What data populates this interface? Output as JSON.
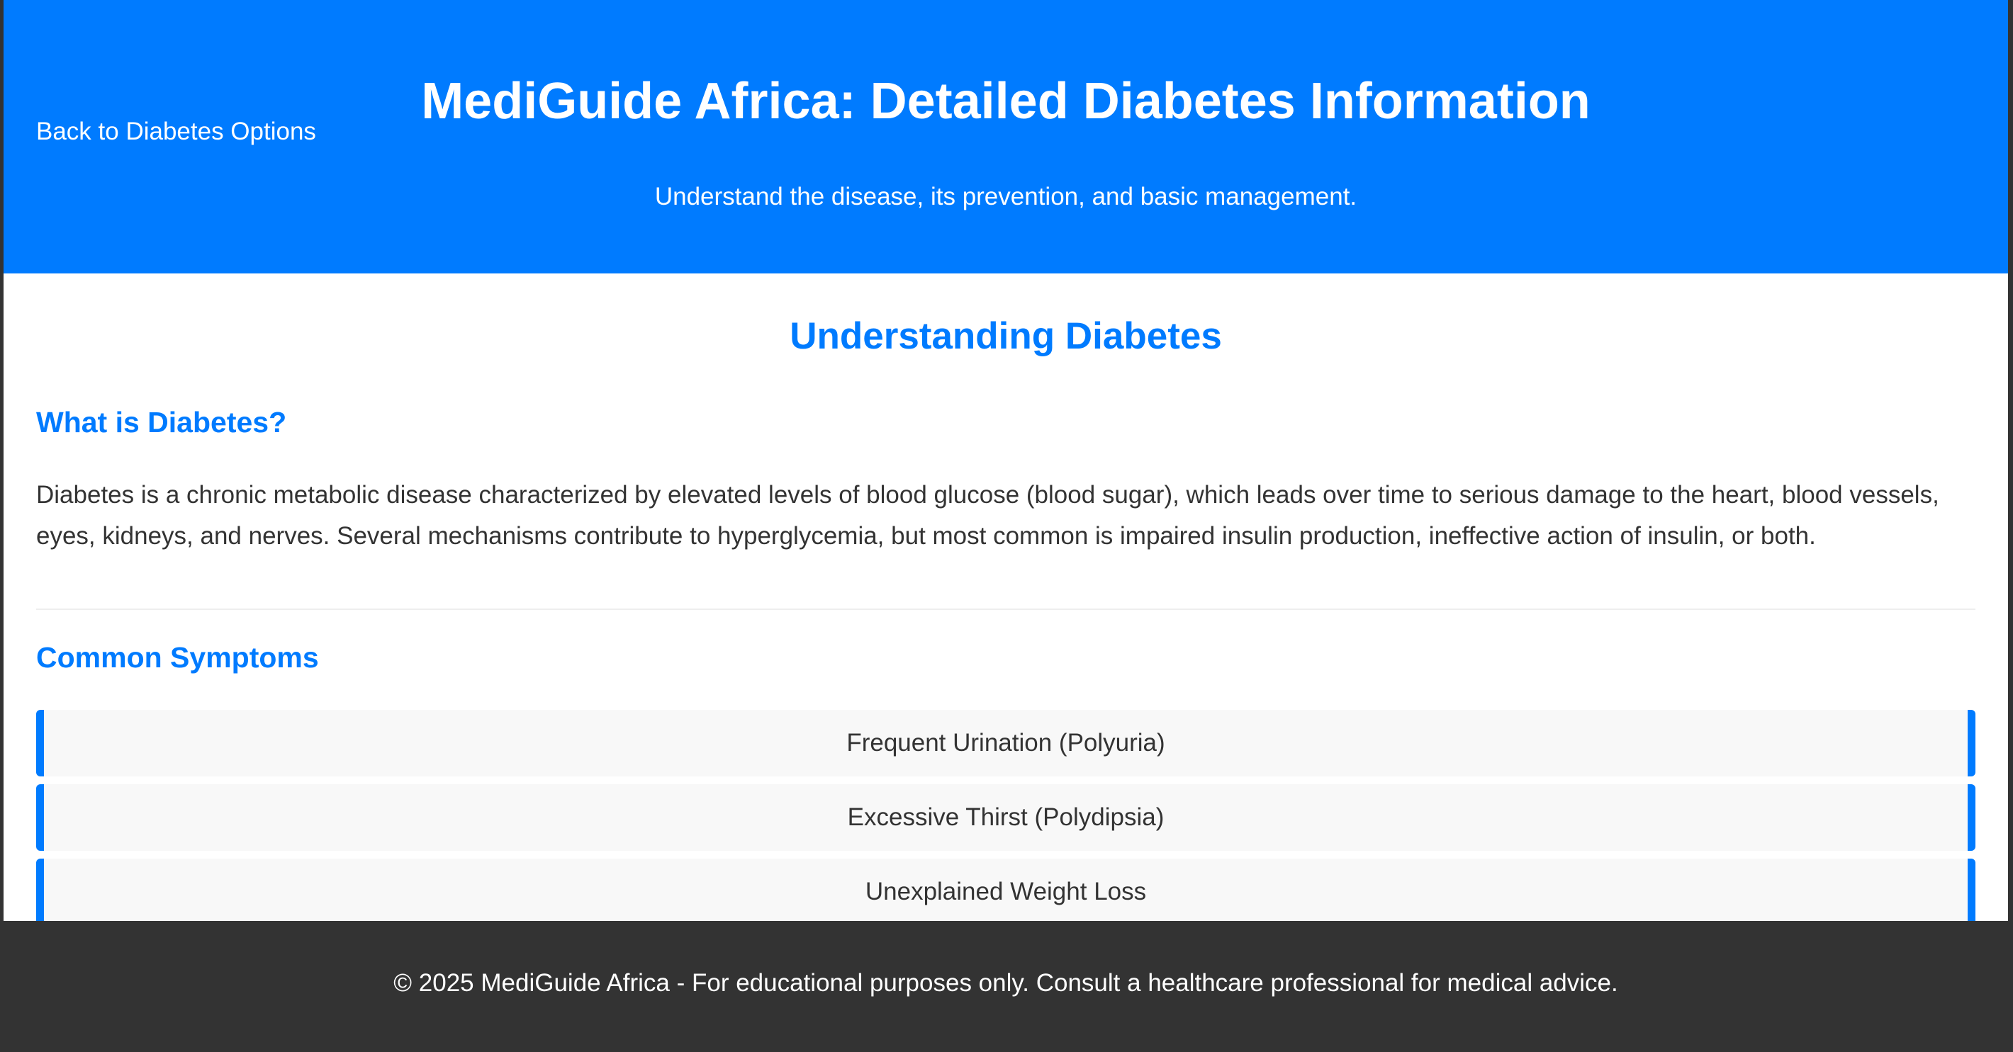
{
  "header": {
    "back_link": "Back to Diabetes Options",
    "title": "MediGuide Africa: Detailed Diabetes Information",
    "subtitle": "Understand the disease, its prevention, and basic management."
  },
  "main": {
    "heading": "Understanding Diabetes",
    "what_is": {
      "title": "What is Diabetes?",
      "text": "Diabetes is a chronic metabolic disease characterized by elevated levels of blood glucose (blood sugar), which leads over time to serious damage to the heart, blood vessels, eyes, kidneys, and nerves. Several mechanisms contribute to hyperglycemia, but most common is impaired insulin production, ineffective action of insulin, or both."
    },
    "symptoms": {
      "title": "Common Symptoms",
      "items": [
        "Frequent Urination (Polyuria)",
        "Excessive Thirst (Polydipsia)",
        "Unexplained Weight Loss"
      ]
    }
  },
  "footer": {
    "text": "© 2025 MediGuide Africa - For educational purposes only. Consult a healthcare professional for medical advice."
  },
  "colors": {
    "primary": "#007bff",
    "footer_bg": "#333333",
    "card_bg": "#f8f8f8",
    "text": "#333333"
  }
}
